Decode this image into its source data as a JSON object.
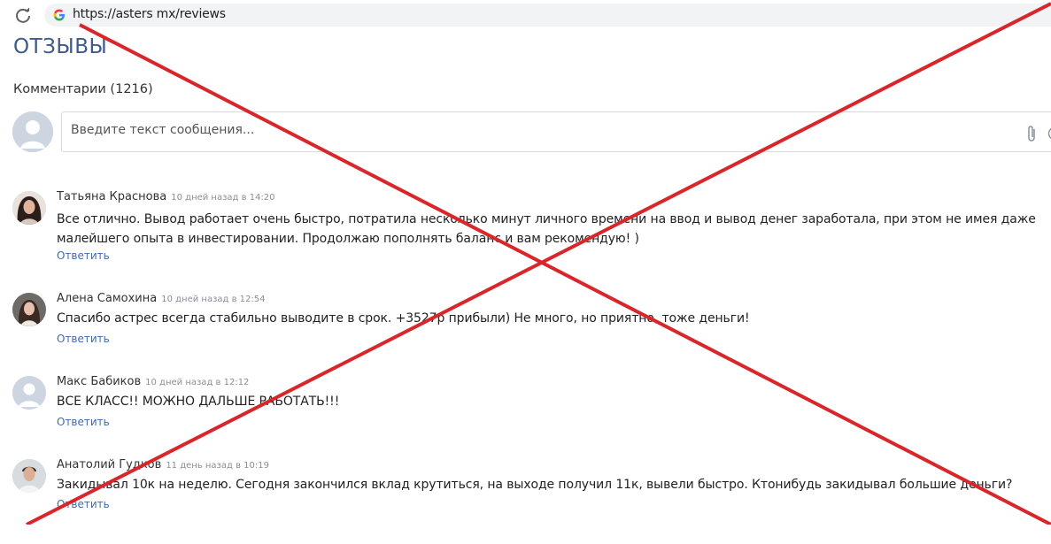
{
  "browser": {
    "url": "https://asters mx/reviews"
  },
  "page": {
    "title": "ОТЗЫВЫ",
    "comments_count": "Комментарии (1216)"
  },
  "composer": {
    "placeholder": "Введите текст сообщения..."
  },
  "comments": [
    {
      "author": "Татьяна Краснова",
      "date": "10 дней назад в 14:20",
      "text": "Все отлично. Вывод работает очень быстро, потратила несколько минут личного времени на ввод и вывод денег заработала, при этом не имея даже малейшего опыта в инвестировании. Продолжаю пополнять баланс и вам рекомендую! )",
      "reply": "Ответить"
    },
    {
      "author": "Алена Самохина",
      "date": "10 дней назад в 12:54",
      "text": "Спасибо астрес всегда стабильно выводите в срок. +3527р прибыли) Не много, но приятно, тоже деньги!",
      "reply": "Ответить"
    },
    {
      "author": "Макс Бабиков",
      "date": "10 дней назад в 12:12",
      "text": "ВСЕ КЛАСС!! МОЖНО ДАЛЬШЕ РАБОТАТЬ!!!",
      "reply": "Ответить"
    },
    {
      "author": "Анатолий Гудков",
      "date": "11 день назад в 10:19",
      "text": "Закидывал 10к на неделю. Сегодня закончился вклад крутиться, на выходе получил 11к, вывели быстро. Ктонибудь закидывал большие деньги?",
      "reply": "Ответить"
    }
  ],
  "icons": {
    "reload": "reload-icon",
    "google": "google-icon",
    "attach": "paperclip-icon",
    "emoji": "emoji-icon"
  },
  "colors": {
    "title": "#3d5a8a",
    "link": "#3b6cb0",
    "cross": "#d9262b",
    "date": "#8b8f96"
  }
}
